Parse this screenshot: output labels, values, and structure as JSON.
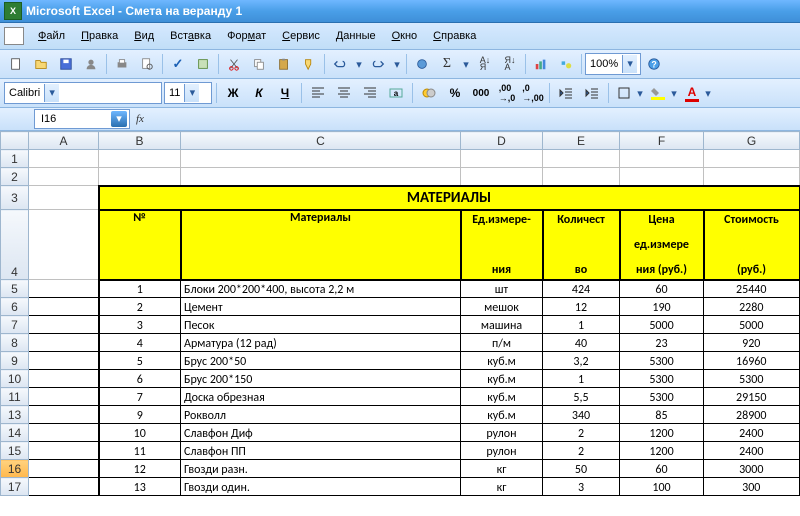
{
  "app": {
    "name": "Microsoft Excel",
    "doc": "Смета на веранду 1"
  },
  "menu": {
    "file": "Файл",
    "edit": "Правка",
    "view": "Вид",
    "insert": "Вставка",
    "format": "Формат",
    "service": "Сервис",
    "data": "Данные",
    "window": "Окно",
    "help": "Справка"
  },
  "toolbar": {
    "zoom": "100%"
  },
  "fmt": {
    "font": "Calibri",
    "size": "11",
    "bold": "Ж",
    "italic": "К",
    "underline": "Ч"
  },
  "namebox": "I16",
  "columns": [
    "A",
    "B",
    "C",
    "D",
    "E",
    "F",
    "G"
  ],
  "rownums": [
    "1",
    "2",
    "3",
    "4",
    "5",
    "6",
    "7",
    "8",
    "9",
    "10",
    "11",
    "13",
    "14",
    "15",
    "16",
    "17"
  ],
  "headers": {
    "section": "МАТЕРИАЛЫ",
    "num": "№",
    "material": "Материалы",
    "unit1": "Ед.измере-",
    "unit2": "ния",
    "qty1": "Количест",
    "qty2": "во",
    "price1": "Цена",
    "price2": "ед.измере",
    "price3": "ния (руб.)",
    "cost1": "Стоимость",
    "cost2": "(руб.)"
  },
  "rows": [
    {
      "n": "1",
      "name": "Блоки 200*200*400, высота 2,2 м",
      "unit": "шт",
      "qty": "424",
      "price": "60",
      "cost": "25440"
    },
    {
      "n": "2",
      "name": "Цемент",
      "unit": "мешок",
      "qty": "12",
      "price": "190",
      "cost": "2280"
    },
    {
      "n": "3",
      "name": "Песок",
      "unit": "машина",
      "qty": "1",
      "price": "5000",
      "cost": "5000"
    },
    {
      "n": "4",
      "name": "Арматура (12 рад)",
      "unit": "п/м",
      "qty": "40",
      "price": "23",
      "cost": "920"
    },
    {
      "n": "5",
      "name": "Брус 200*50",
      "unit": "куб.м",
      "qty": "3,2",
      "price": "5300",
      "cost": "16960"
    },
    {
      "n": "6",
      "name": "Брус 200*150",
      "unit": "куб.м",
      "qty": "1",
      "price": "5300",
      "cost": "5300"
    },
    {
      "n": "7",
      "name": "Доска обрезная",
      "unit": "куб.м",
      "qty": "5,5",
      "price": "5300",
      "cost": "29150"
    },
    {
      "n": "9",
      "name": "Рокволл",
      "unit": "куб.м",
      "qty": "340",
      "price": "85",
      "cost": "28900"
    },
    {
      "n": "10",
      "name": "Славфон Диф",
      "unit": "рулон",
      "qty": "2",
      "price": "1200",
      "cost": "2400"
    },
    {
      "n": "11",
      "name": "Славфон ПП",
      "unit": "рулон",
      "qty": "2",
      "price": "1200",
      "cost": "2400"
    },
    {
      "n": "12",
      "name": "Гвозди разн.",
      "unit": "кг",
      "qty": "50",
      "price": "60",
      "cost": "3000"
    },
    {
      "n": "13",
      "name": "Гвозди один.",
      "unit": "кг",
      "qty": "3",
      "price": "100",
      "cost": "300"
    }
  ]
}
